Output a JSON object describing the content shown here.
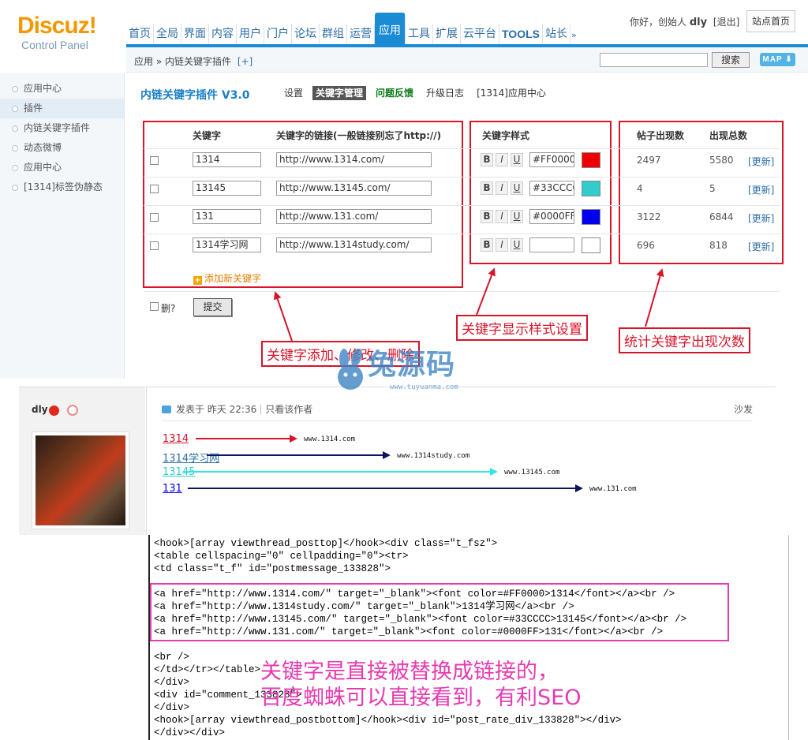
{
  "header": {
    "logo_main": "Discuz!",
    "logo_sub": "Control Panel",
    "nav": [
      {
        "label": "首页"
      },
      {
        "label": "全局"
      },
      {
        "label": "界面"
      },
      {
        "label": "内容"
      },
      {
        "label": "用户"
      },
      {
        "label": "门户"
      },
      {
        "label": "论坛"
      },
      {
        "label": "群组"
      },
      {
        "label": "运营"
      },
      {
        "label": "应用",
        "active": true
      },
      {
        "label": "工具"
      },
      {
        "label": "扩展"
      },
      {
        "label": "云平台"
      },
      {
        "label": "TOOLS"
      },
      {
        "label": "站长"
      }
    ],
    "nav_more": "»",
    "greeting": "你好，创始人",
    "username": "dly",
    "logout": "[退出]",
    "site_home": "站点首页"
  },
  "breadcrumb": {
    "text": "应用 » 内链关键字插件",
    "add": "[+]"
  },
  "search": {
    "value": "",
    "button": "搜索",
    "map": "MAP ⬇"
  },
  "sidebar": {
    "items": [
      {
        "label": "应用中心"
      },
      {
        "label": "插件",
        "active": true
      },
      {
        "label": "内链关键字插件"
      },
      {
        "label": "动态微博"
      },
      {
        "label": "应用中心"
      },
      {
        "label": "[1314]标签伪静态"
      }
    ]
  },
  "plugin": {
    "title": "内链关键字插件 V3.0",
    "tabs": [
      {
        "label": "设置"
      },
      {
        "label": "关键字管理",
        "active": true
      },
      {
        "label": "问题反馈",
        "green": true
      },
      {
        "label": "升级日志"
      },
      {
        "label": "[1314]应用中心"
      }
    ]
  },
  "table": {
    "col_keyword": "关键字",
    "col_link": "关键字的链接(一般链接别忘了http://)",
    "col_style": "关键字样式",
    "col_post_count": "帖子出现数",
    "col_total": "出现总数",
    "rows": [
      {
        "keyword": "1314",
        "link": "http://www.1314.com/",
        "color": "#FF0000",
        "swatch": "#ee0000",
        "post_count": "2497",
        "total": "5580",
        "update": "[更新]"
      },
      {
        "keyword": "13145",
        "link": "http://www.13145.com/",
        "color": "#33CCCC",
        "swatch": "#33cccc",
        "post_count": "4",
        "total": "5",
        "update": "[更新]"
      },
      {
        "keyword": "131",
        "link": "http://www.131.com/",
        "color": "#0000FF",
        "swatch": "#0000ee",
        "post_count": "3122",
        "total": "6844",
        "update": "[更新]"
      },
      {
        "keyword": "1314学习网",
        "link": "http://www.1314study.com/",
        "color": "",
        "swatch": "#ffffff",
        "post_count": "696",
        "total": "818",
        "update": "[更新]"
      }
    ],
    "fmt": {
      "bold": "B",
      "italic": "I",
      "underline": "U"
    },
    "add_keyword": "添加新关键字",
    "delete_label": "删?",
    "submit": "提交"
  },
  "annotations": {
    "add_edit_delete": "关键字添加、修改、删除",
    "style_setting": "关键字显示样式设置",
    "count_stats": "统计关键字出现次数"
  },
  "watermark": {
    "text": "兔源码",
    "url": "www.tuyuanma.com"
  },
  "forum": {
    "poster": "dly",
    "post_meta": "发表于 昨天 22:36",
    "author_only": "只看该作者",
    "sofa": "沙发",
    "links": [
      {
        "text": "1314",
        "color": "#d7142a",
        "url": "www.1314.com"
      },
      {
        "text": "1314学习网",
        "color": "#2c6da6",
        "url": "www.1314study.com"
      },
      {
        "text": "13145",
        "color": "#33cccc",
        "url": "www.13145.com"
      },
      {
        "text": "131",
        "color": "#0000ee",
        "url": "www.131.com"
      }
    ]
  },
  "code": {
    "lines": [
      "<hook>[array viewthread_posttop]</hook><div class=\"t_fsz\">",
      "<table cellspacing=\"0\" cellpadding=\"0\"><tr>",
      "<td class=\"t_f\" id=\"postmessage_133828\">",
      "",
      "<a href=\"http://www.1314.com/\" target=\"_blank\"><font color=#FF0000>1314</font></a><br />",
      "<a href=\"http://www.1314study.com/\" target=\"_blank\">1314学习网</a><br />",
      "<a href=\"http://www.13145.com/\" target=\"_blank\"><font color=#33CCCC>13145</font></a><br />",
      "<a href=\"http://www.131.com/\" target=\"_blank\"><font color=#0000FF>131</font></a><br />",
      "",
      "<br />",
      "</td></tr></table>",
      "</div>",
      "<div id=\"comment_133828\">",
      "</div>",
      "<hook>[array viewthread_postbottom]</hook><div id=\"post_rate_div_133828\"></div>",
      "</div></div>"
    ],
    "note_line1": "关键字是直接被替换成链接的，",
    "note_line2": "百度蜘蛛可以直接看到，有利SEO"
  },
  "colors": {
    "accent": "#1b8bd4",
    "annotation_red": "#d7142a",
    "annotation_pink": "#e63ab1"
  }
}
